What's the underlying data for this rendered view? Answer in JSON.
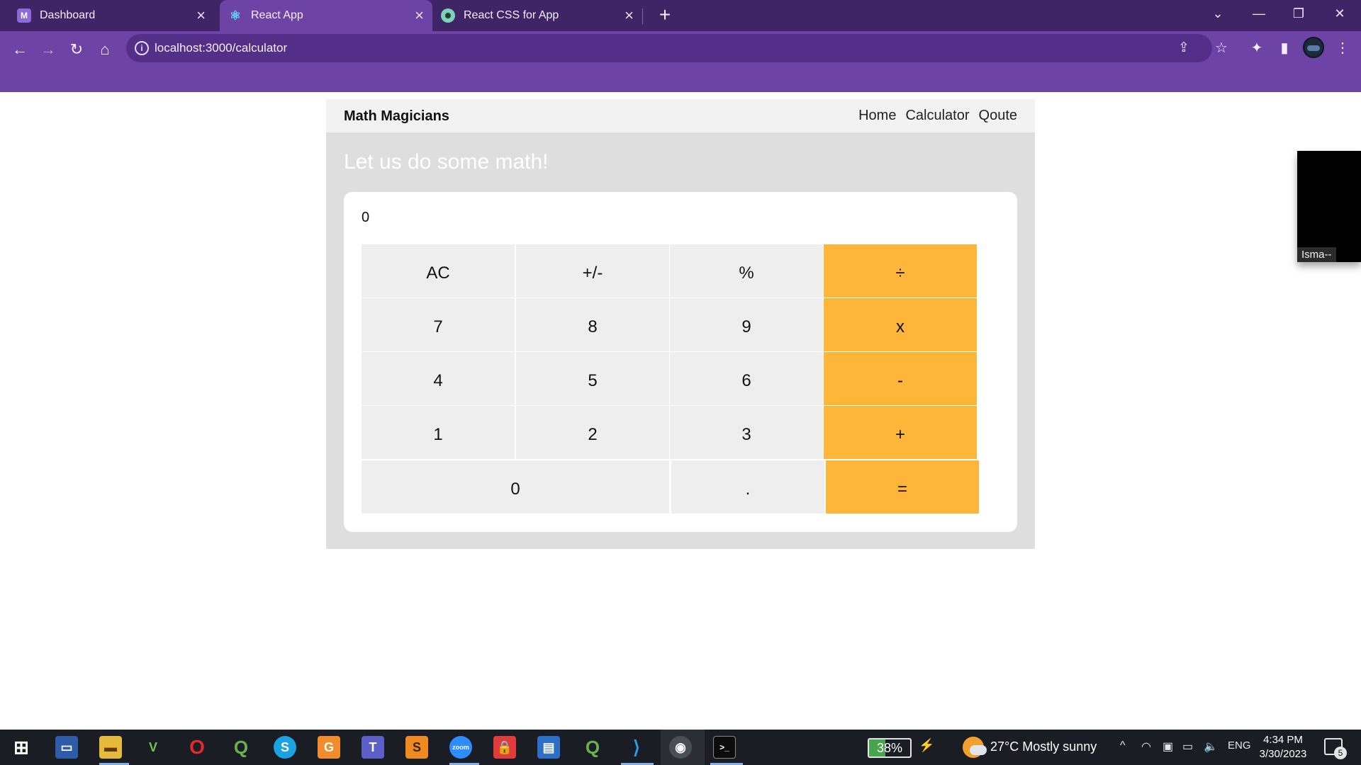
{
  "browser": {
    "tabs": [
      {
        "title": "Dashboard",
        "icon": "dashboard-favicon",
        "active": false
      },
      {
        "title": "React App",
        "icon": "react-favicon",
        "active": true
      },
      {
        "title": "React CSS for App",
        "icon": "chatgpt-favicon",
        "active": false
      }
    ],
    "url": "localhost:3000/calculator"
  },
  "app": {
    "brand": "Math Magicians",
    "nav": [
      "Home",
      "Calculator",
      "Qoute"
    ],
    "heading": "Let us do some math!",
    "display": "0",
    "keys": {
      "row1": [
        "AC",
        "+/-",
        "%",
        "÷"
      ],
      "row2": [
        "7",
        "8",
        "9",
        "x"
      ],
      "row3": [
        "4",
        "5",
        "6",
        "-"
      ],
      "row4": [
        "1",
        "2",
        "3",
        "+"
      ],
      "row5": [
        "0",
        ".",
        "="
      ]
    },
    "colors": {
      "operator": "#fdb63a",
      "key": "#eeeeee",
      "panel": "#dedede"
    }
  },
  "video_thumbnail": {
    "label": "Isma--"
  },
  "taskbar": {
    "battery": "38%",
    "weather": "27°C  Mostly sunny",
    "language": "ENG",
    "time": "4:34 PM",
    "date": "3/30/2023",
    "notifications": "5"
  }
}
